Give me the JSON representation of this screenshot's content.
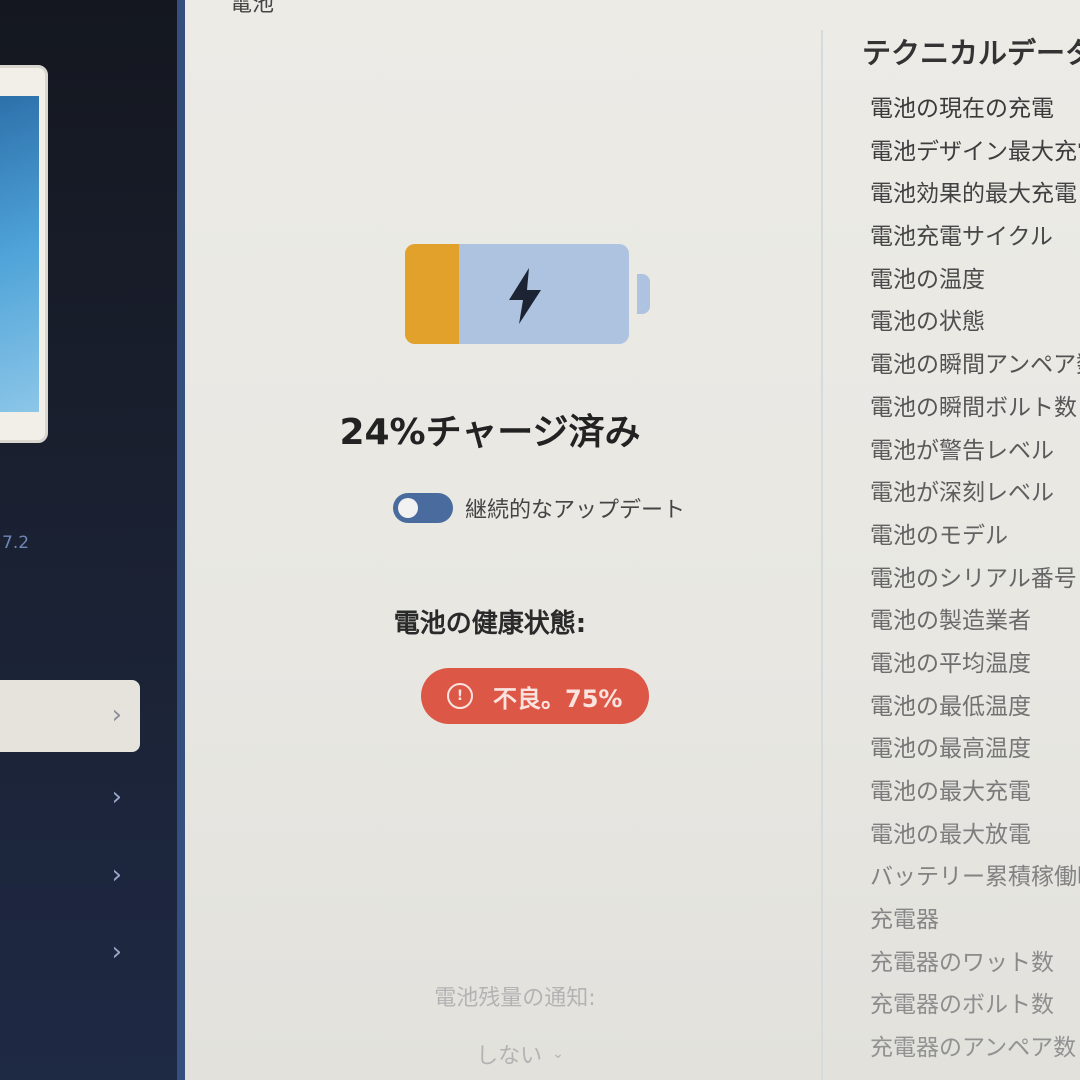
{
  "sidebar": {
    "version_text": "7.2",
    "nav_chevrons": [
      "›",
      "›",
      "›",
      "›"
    ]
  },
  "main": {
    "top_title": "電池",
    "battery": {
      "charge_percent": 24,
      "fill_color": "#e2a12a",
      "body_color": "#aec3df",
      "icon": "lightning-bolt-icon"
    },
    "charge_label": "24%チャージ済み",
    "toggle": {
      "label": "継続的なアップデート",
      "on": true
    },
    "health_label": "電池の健康状態:",
    "health_badge": {
      "text": "不良。75%",
      "color": "#dd5747",
      "icon": "alert-circle-icon"
    },
    "notify_label": "電池残量の通知:",
    "notify_value": "しない",
    "notify_chevron": "⌄"
  },
  "tech": {
    "title": "テクニカルデータ",
    "items": [
      "電池の現在の充電",
      "電池デザイン最大充電",
      "電池効果的最大充電",
      "電池充電サイクル",
      "電池の温度",
      "電池の状態",
      "電池の瞬間アンペア数",
      "電池の瞬間ボルト数",
      "電池が警告レベル",
      "電池が深刻レベル",
      "電池のモデル",
      "電池のシリアル番号",
      "電池の製造業者",
      "電池の平均温度",
      "電池の最低温度",
      "電池の最高温度",
      "電池の最大充電",
      "電池の最大放電",
      "バッテリー累積稼働時間",
      "充電器",
      "充電器のワット数",
      "充電器のボルト数",
      "充電器のアンペア数"
    ]
  }
}
